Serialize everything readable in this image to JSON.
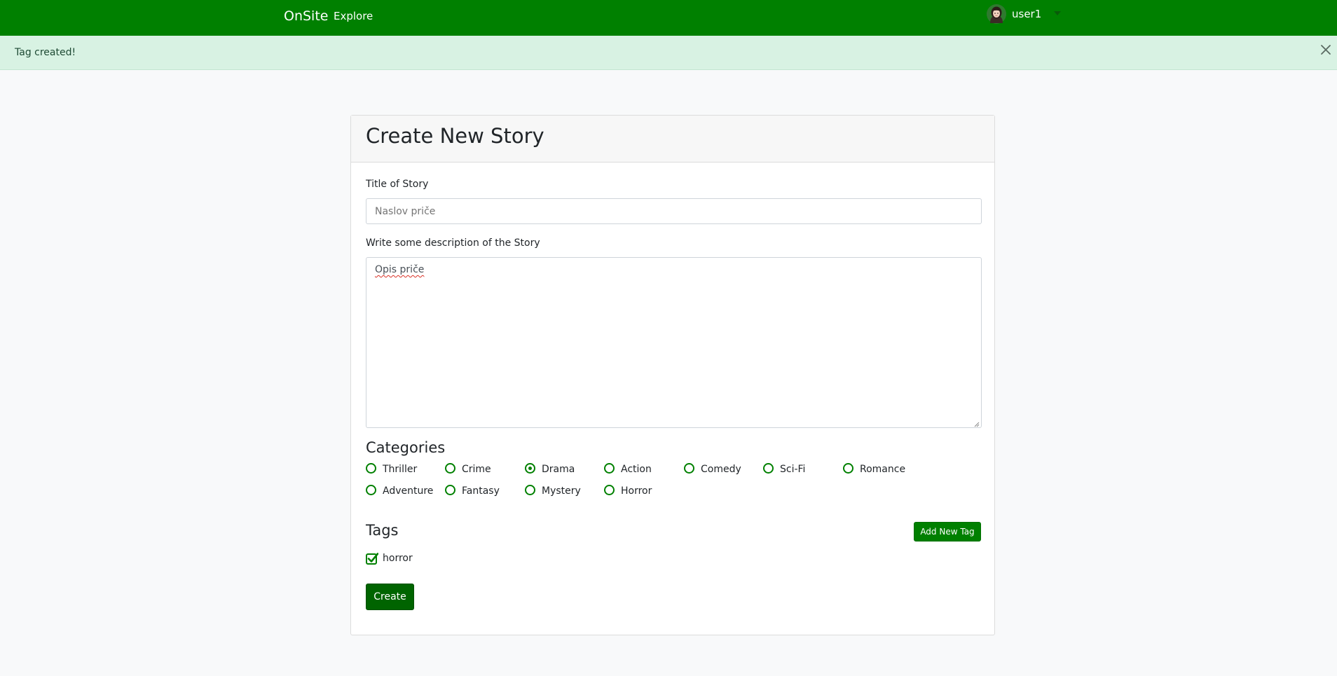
{
  "navbar": {
    "brand": "OnSite",
    "links": [
      "Explore"
    ],
    "user": {
      "name": "user1",
      "avatar_icon": "woman-avatar-icon",
      "caret_icon": "caret-down-icon"
    },
    "color": "#008000"
  },
  "alert": {
    "message": "Tag created!",
    "close_icon": "close-icon",
    "color": "#d8f2e3"
  },
  "form": {
    "title": "Create New Story",
    "story_title": {
      "label": "Title of Story",
      "value": "Naslov priče"
    },
    "description": {
      "label": "Write some description of the Story",
      "value": "Opis priče"
    },
    "categories": {
      "heading": "Categories",
      "options": [
        "Thriller",
        "Crime",
        "Drama",
        "Action",
        "Comedy",
        "Sci-Fi",
        "Romance",
        "Adventure",
        "Fantasy",
        "Mystery",
        "Horror"
      ],
      "selected": "Drama"
    },
    "tags": {
      "heading": "Tags",
      "add_button": "Add New Tag",
      "items": [
        {
          "label": "horror",
          "checked": true
        }
      ]
    },
    "submit_label": "Create"
  }
}
